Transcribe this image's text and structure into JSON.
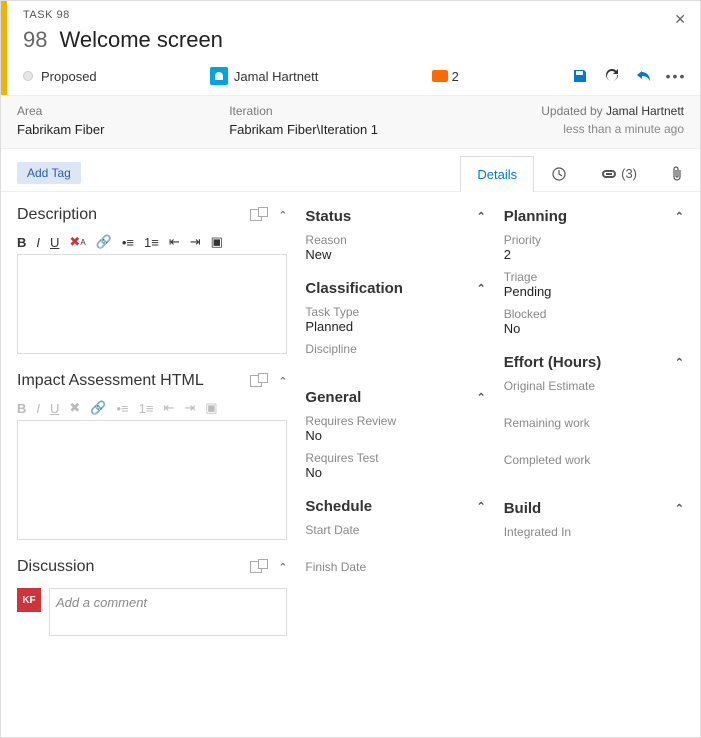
{
  "header": {
    "task_label": "TASK 98",
    "id": "98",
    "title": "Welcome screen",
    "state": "Proposed",
    "assignee": "Jamal Hartnett",
    "comment_count": "2",
    "updated_by_prefix": "Updated by ",
    "updated_by": "Jamal Hartnett",
    "updated_when": "less than a minute ago"
  },
  "area": {
    "label": "Area",
    "value": "Fabrikam Fiber"
  },
  "iteration": {
    "label": "Iteration",
    "value": "Fabrikam Fiber\\Iteration 1"
  },
  "tags": {
    "add_label": "Add Tag"
  },
  "tabs": {
    "details": "Details",
    "links_count": "(3)"
  },
  "left": {
    "description_title": "Description",
    "impact_title": "Impact Assessment HTML",
    "discussion_title": "Discussion",
    "comment_placeholder": "Add a comment",
    "disc_avatar_initials": "KF"
  },
  "status": {
    "title": "Status",
    "reason_label": "Reason",
    "reason_value": "New"
  },
  "classification": {
    "title": "Classification",
    "task_type_label": "Task Type",
    "task_type_value": "Planned",
    "discipline_label": "Discipline"
  },
  "general": {
    "title": "General",
    "requires_review_label": "Requires Review",
    "requires_review_value": "No",
    "requires_test_label": "Requires Test",
    "requires_test_value": "No"
  },
  "schedule": {
    "title": "Schedule",
    "start_label": "Start Date",
    "finish_label": "Finish Date"
  },
  "planning": {
    "title": "Planning",
    "priority_label": "Priority",
    "priority_value": "2",
    "triage_label": "Triage",
    "triage_value": "Pending",
    "blocked_label": "Blocked",
    "blocked_value": "No"
  },
  "effort": {
    "title": "Effort (Hours)",
    "original_label": "Original Estimate",
    "remaining_label": "Remaining work",
    "completed_label": "Completed work"
  },
  "build": {
    "title": "Build",
    "integrated_label": "Integrated In"
  }
}
